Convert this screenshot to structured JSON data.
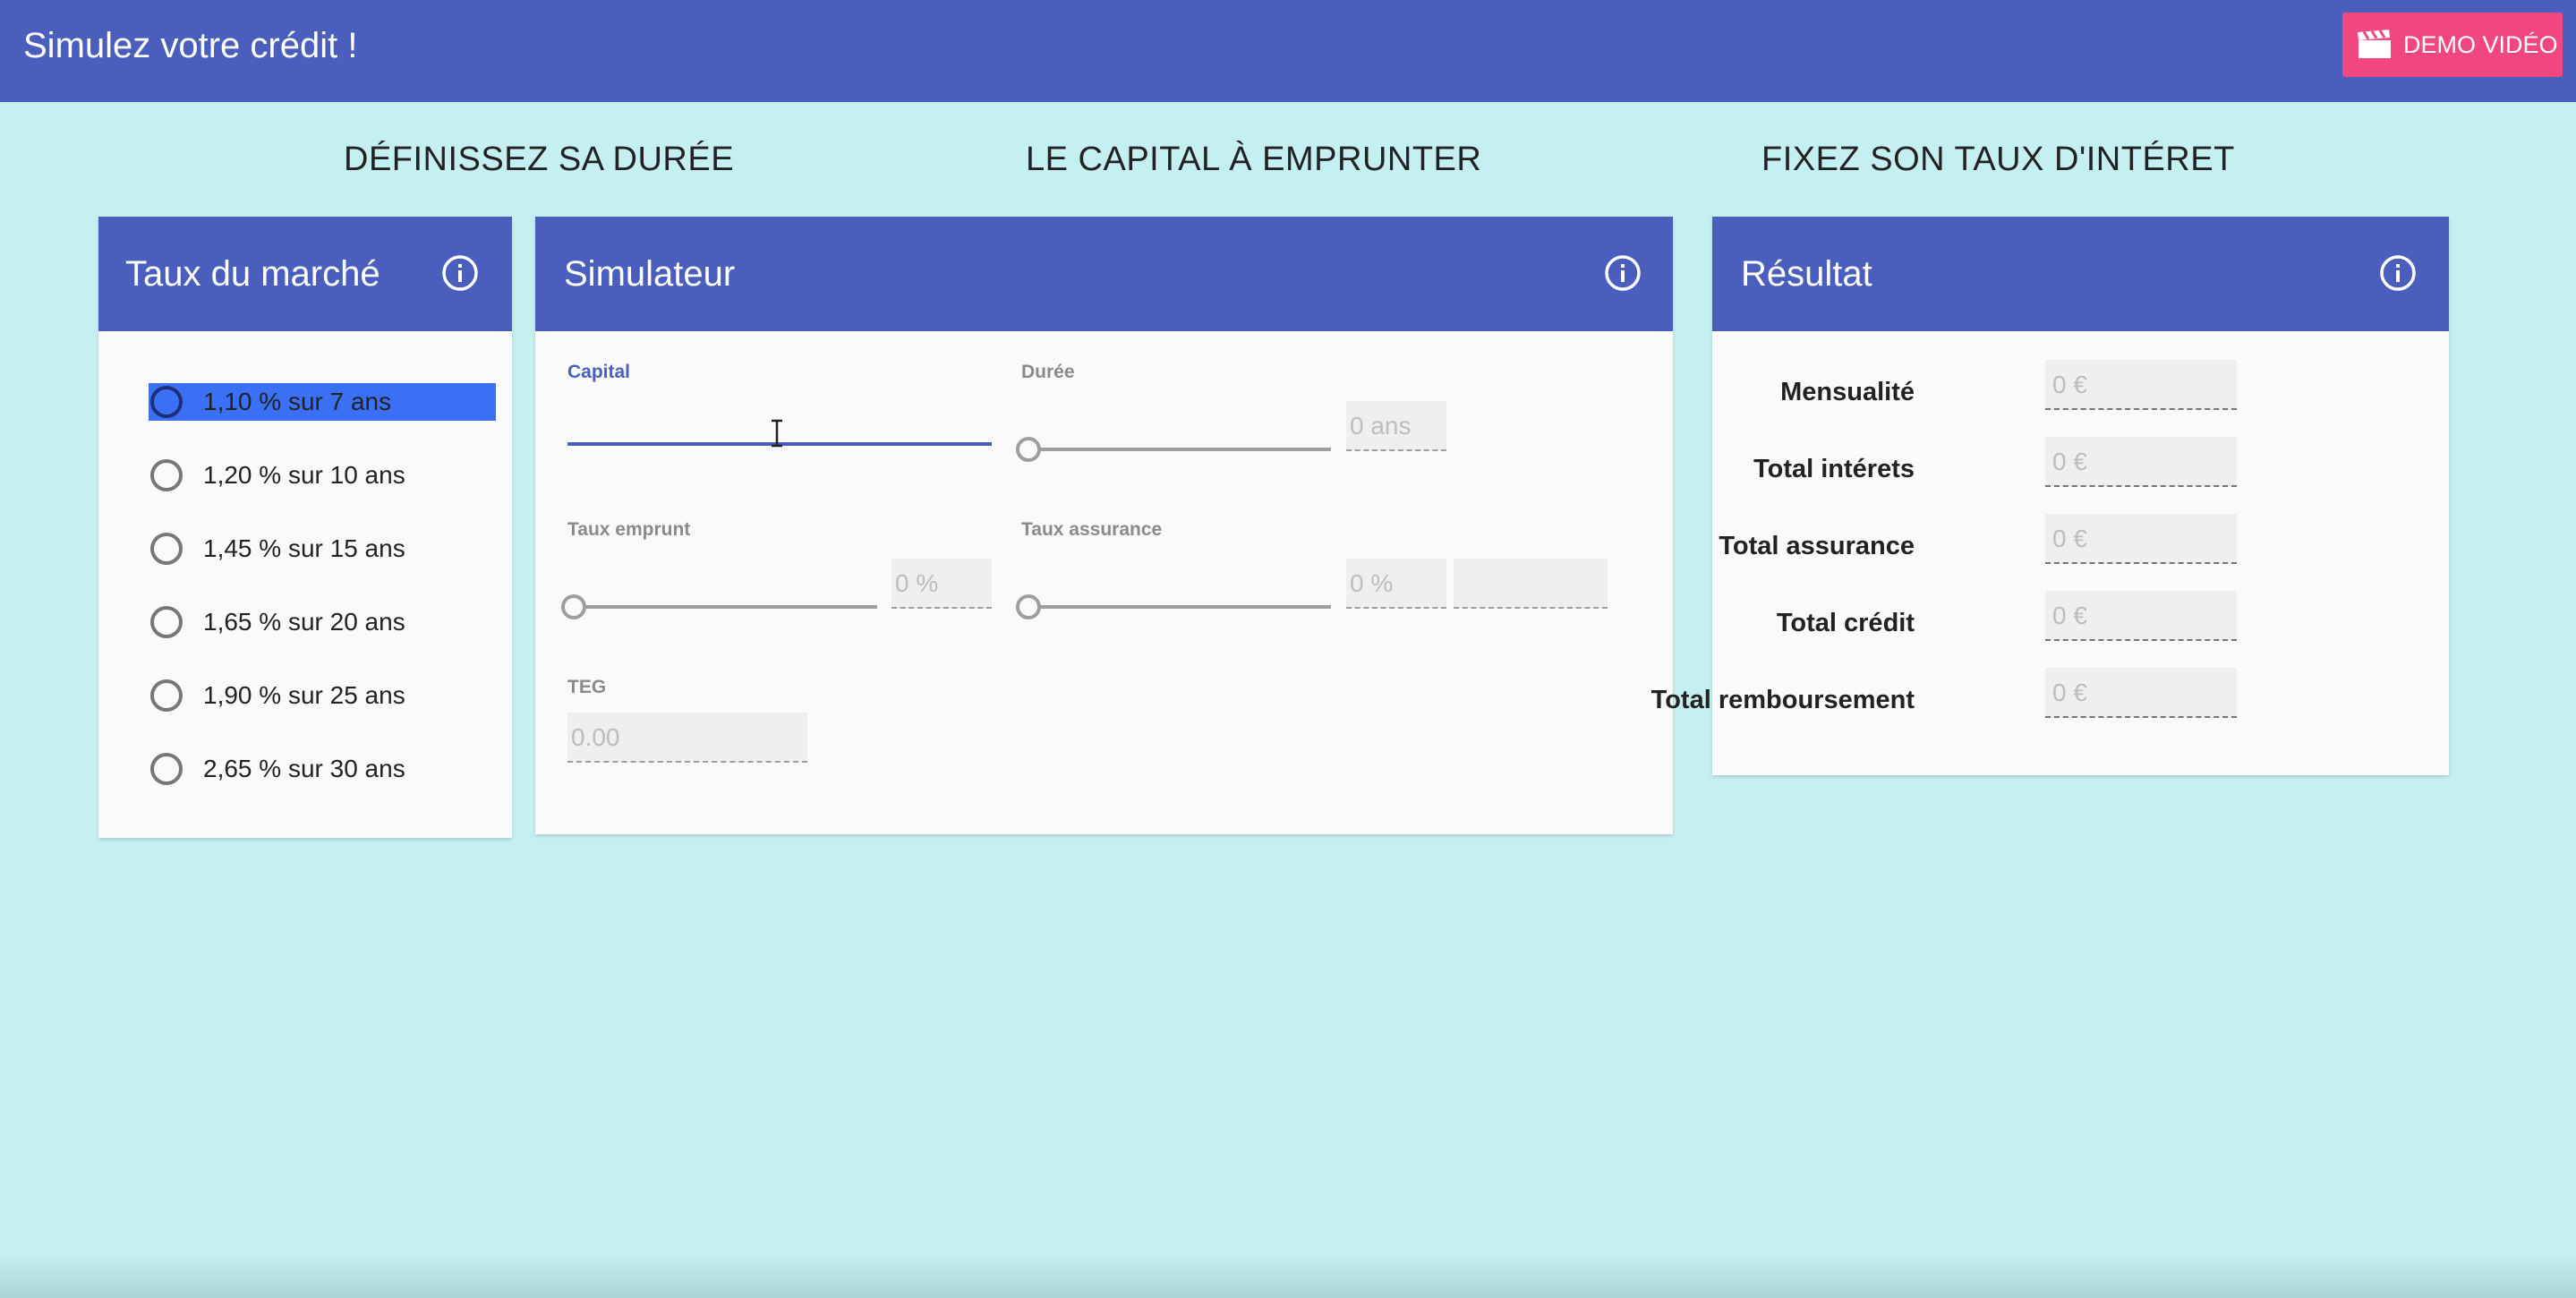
{
  "app": {
    "title": "Simulez votre crédit !",
    "demo_button_label": "DEMO VIDÉO"
  },
  "headings": {
    "duration": "DÉFINISSEZ SA DURÉE",
    "capital": "LE CAPITAL À EMPRUNTER",
    "rate": "FIXEZ SON TAUX D'INTÉRET"
  },
  "market_rates": {
    "title": "Taux du marché",
    "items": [
      {
        "label": "1,10 % sur 7 ans",
        "selected": true
      },
      {
        "label": "1,20 % sur 10 ans",
        "selected": false
      },
      {
        "label": "1,45 % sur 15 ans",
        "selected": false
      },
      {
        "label": "1,65 % sur 20 ans",
        "selected": false
      },
      {
        "label": "1,90 % sur 25 ans",
        "selected": false
      },
      {
        "label": "2,65 % sur 30 ans",
        "selected": false
      }
    ]
  },
  "simulator": {
    "title": "Simulateur",
    "capital": {
      "label": "Capital",
      "value": ""
    },
    "duree": {
      "label": "Durée",
      "value": "0 ans",
      "slider_level": 0
    },
    "taux_emprunt": {
      "label": "Taux emprunt",
      "value": "0 %",
      "slider_level": 0
    },
    "taux_assurance": {
      "label": "Taux assurance",
      "value": "0 %",
      "extra_value": "",
      "slider_level": 0
    },
    "teg": {
      "label": "TEG",
      "value": "0.00"
    }
  },
  "result": {
    "title": "Résultat",
    "rows": [
      {
        "label": "Mensualité",
        "value": "0 €"
      },
      {
        "label": "Total intérets",
        "value": "0 €"
      },
      {
        "label": "Total assurance",
        "value": "0 €"
      },
      {
        "label": "Total crédit",
        "value": "0 €"
      },
      {
        "label": "Total remboursement",
        "value": "0 €"
      }
    ]
  },
  "colors": {
    "primary": "#4a5fbd",
    "accent": "#f2477e",
    "background": "#c5f0f2",
    "selection": "#3b6ff5"
  },
  "icons": {
    "info": "info-icon",
    "video": "movie-clapper-icon",
    "text_cursor": "text-cursor-icon"
  }
}
